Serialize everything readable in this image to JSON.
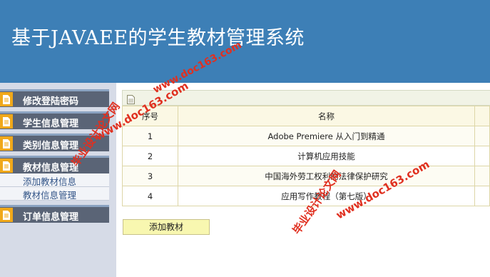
{
  "header": {
    "title": "基于JAVAEE的学生教材管理系统"
  },
  "sidebar": {
    "items": [
      {
        "label": "修改登陆密码",
        "icon": "document-icon"
      },
      {
        "label": "学生信息管理",
        "icon": "document-icon"
      },
      {
        "label": "类别信息管理",
        "icon": "document-icon"
      },
      {
        "label": "教材信息管理",
        "icon": "document-icon",
        "children": [
          {
            "label": "添加教材信息"
          },
          {
            "label": "教材信息管理"
          }
        ]
      },
      {
        "label": "订单信息管理",
        "icon": "document-icon"
      }
    ]
  },
  "table": {
    "columns": [
      "序号",
      "名称"
    ],
    "rows": [
      [
        "1",
        "Adobe Premiere 从入门到精通"
      ],
      [
        "2",
        "计算机应用技能"
      ],
      [
        "3",
        "中国海外劳工权利的法律保护研究"
      ],
      [
        "4",
        "应用写作教程（第七版）"
      ]
    ]
  },
  "actions": {
    "add_label": "添加教材"
  },
  "watermarks": [
    "www.doc163.com",
    "毕业设计论文网",
    "www.doc163.com",
    "毕业设计论文网",
    "www.doc163.com"
  ],
  "colors": {
    "header_bg": "#3d7fb6",
    "sidebar_bg": "#d6dbe7",
    "menu_bg": "#5a6476",
    "menu_icon": "#f0a81a",
    "watermark": "#e03020"
  }
}
